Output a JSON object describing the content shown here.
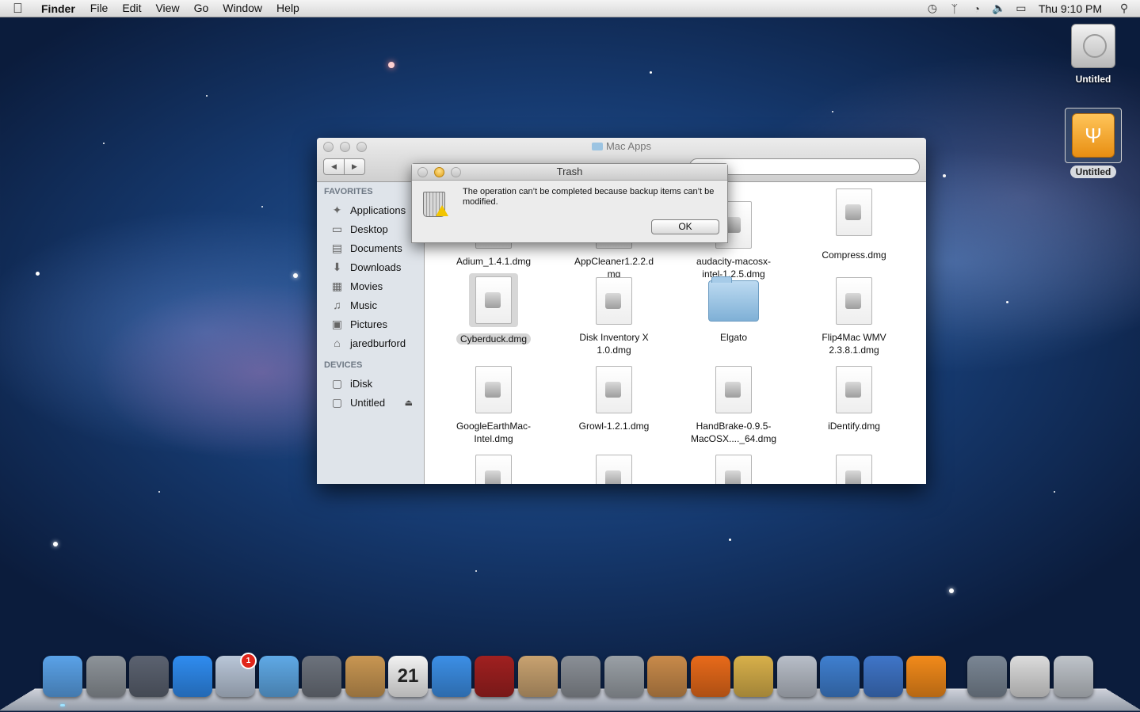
{
  "menubar": {
    "app_name": "Finder",
    "menus": [
      "File",
      "Edit",
      "View",
      "Go",
      "Window",
      "Help"
    ],
    "status_icons": [
      "time-machine-icon",
      "bluetooth-icon",
      "wifi-icon",
      "volume-icon",
      "battery-icon"
    ],
    "clock": "Thu 9:10 PM"
  },
  "desktop_icons": [
    {
      "label": "Untitled",
      "icon": "hard-drive-icon",
      "selected": false
    },
    {
      "label": "Untitled",
      "icon": "usb-drive-icon",
      "selected": true
    }
  ],
  "finder": {
    "title": "Mac Apps",
    "sidebar": {
      "favorites_header": "FAVORITES",
      "favorites": [
        {
          "label": "Applications",
          "icon": "applications-icon"
        },
        {
          "label": "Desktop",
          "icon": "desktop-icon"
        },
        {
          "label": "Documents",
          "icon": "documents-icon"
        },
        {
          "label": "Downloads",
          "icon": "downloads-icon"
        },
        {
          "label": "Movies",
          "icon": "movies-icon"
        },
        {
          "label": "Music",
          "icon": "music-icon"
        },
        {
          "label": "Pictures",
          "icon": "pictures-icon"
        },
        {
          "label": "jaredburford",
          "icon": "home-icon"
        }
      ],
      "devices_header": "DEVICES",
      "devices": [
        {
          "label": "iDisk",
          "icon": "idisk-icon"
        },
        {
          "label": "Untitled",
          "icon": "drive-icon",
          "eject": true
        }
      ]
    },
    "files": [
      {
        "name": "Adium_1.4.1.dmg",
        "type": "dmg"
      },
      {
        "name": "AppCleaner1.2.2.d mg",
        "type": "dmg"
      },
      {
        "name": "audacity-macosx- intel-1.2.5.dmg",
        "type": "dmg"
      },
      {
        "name": "Compress.dmg",
        "type": "dmg"
      },
      {
        "name": "Cyberduck.dmg",
        "type": "dmg",
        "selected": true
      },
      {
        "name": "Disk Inventory X 1.0.dmg",
        "type": "dmg"
      },
      {
        "name": "Elgato",
        "type": "folder"
      },
      {
        "name": "Flip4Mac WMV 2.3.8.1.dmg",
        "type": "dmg"
      },
      {
        "name": "GoogleEarthMac- Intel.dmg",
        "type": "dmg"
      },
      {
        "name": "Growl-1.2.1.dmg",
        "type": "dmg"
      },
      {
        "name": "HandBrake-0.9.5- MacOSX...._64.dmg",
        "type": "dmg"
      },
      {
        "name": "iDentify.dmg",
        "type": "dmg"
      }
    ]
  },
  "alert": {
    "title": "Trash",
    "message": "The operation can’t be completed because backup items can’t be modified.",
    "ok_label": "OK"
  },
  "dock": {
    "items": [
      {
        "name": "finder",
        "color": "#5aa2e8"
      },
      {
        "name": "launchpad",
        "color": "#8d9399"
      },
      {
        "name": "photo-booth",
        "color": "#5b6270"
      },
      {
        "name": "app-store",
        "color": "#2f8cf0"
      },
      {
        "name": "mail",
        "color": "#b9c6d8",
        "badge": "1"
      },
      {
        "name": "safari",
        "color": "#5fa9e6"
      },
      {
        "name": "facetime",
        "color": "#6c727c"
      },
      {
        "name": "address-book",
        "color": "#c89652"
      },
      {
        "name": "ical",
        "color": "#f2f2f2",
        "text": "21"
      },
      {
        "name": "itunes",
        "color": "#3c8fe6"
      },
      {
        "name": "photo-browser",
        "color": "#a02020"
      },
      {
        "name": "iphoto",
        "color": "#c8a270"
      },
      {
        "name": "system-preferences",
        "color": "#8a8f96"
      },
      {
        "name": "app-cleaner",
        "color": "#9aa0a6"
      },
      {
        "name": "compress",
        "color": "#c88a4a"
      },
      {
        "name": "firefox",
        "color": "#e86a1a"
      },
      {
        "name": "adium",
        "color": "#d8b04a"
      },
      {
        "name": "ichat",
        "color": "#b8bec8"
      },
      {
        "name": "remote-desktop",
        "color": "#3f7fd0"
      },
      {
        "name": "ftp-client",
        "color": "#3f75c8"
      },
      {
        "name": "vlc",
        "color": "#f28a1a"
      },
      {
        "name": "documents-stack",
        "color": "#7a8694"
      },
      {
        "name": "downloads-stack",
        "color": "#dcdcdc"
      },
      {
        "name": "trash",
        "color": "#bfc4ca"
      }
    ]
  }
}
